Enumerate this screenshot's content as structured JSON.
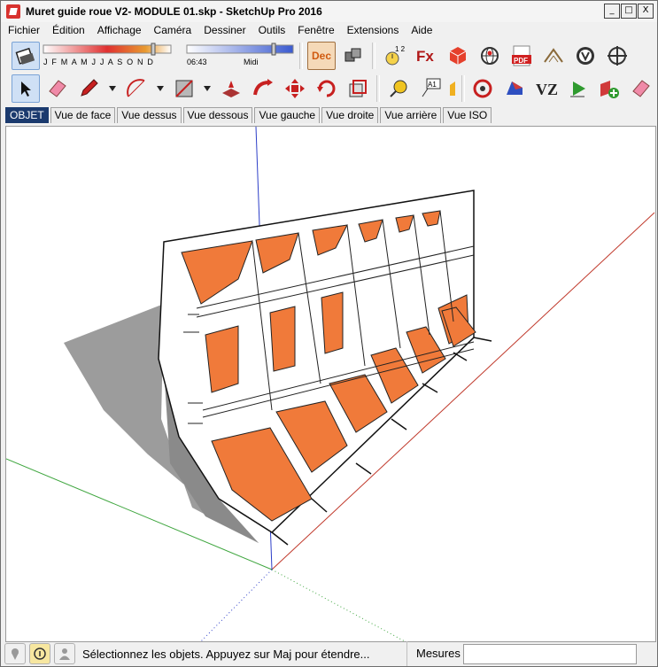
{
  "window": {
    "title": "Muret guide roue V2- MODULE 01.skp - SketchUp Pro 2016"
  },
  "window_controls": [
    "_",
    "□",
    "X"
  ],
  "menu": [
    "Fichier",
    "Édition",
    "Affichage",
    "Caméra",
    "Dessiner",
    "Outils",
    "Fenêtre",
    "Extensions",
    "Aide"
  ],
  "shadow": {
    "months": "J F M A M J J A S O N D",
    "time": "06:43",
    "noon": "Midi",
    "dec_label": "Dec"
  },
  "toolbar2": {
    "text_label": "A1"
  },
  "tabs": [
    "OBJET",
    "Vue de face",
    "Vue dessus",
    "Vue dessous",
    "Vue gauche",
    "Vue droite",
    "Vue arrière",
    "Vue ISO"
  ],
  "status": {
    "message": "Sélectionnez les objets. Appuyez sur Maj pour étendre...",
    "measure_label": "Mesures",
    "measure_value": ""
  },
  "colors": {
    "accent_orange": "#f07a3a",
    "axis_red": "#c0392b",
    "axis_green": "#3fa63f",
    "axis_blue": "#2d3fc8",
    "shadow": "#9c9c9c",
    "active_tab": "#1b3a6e"
  }
}
